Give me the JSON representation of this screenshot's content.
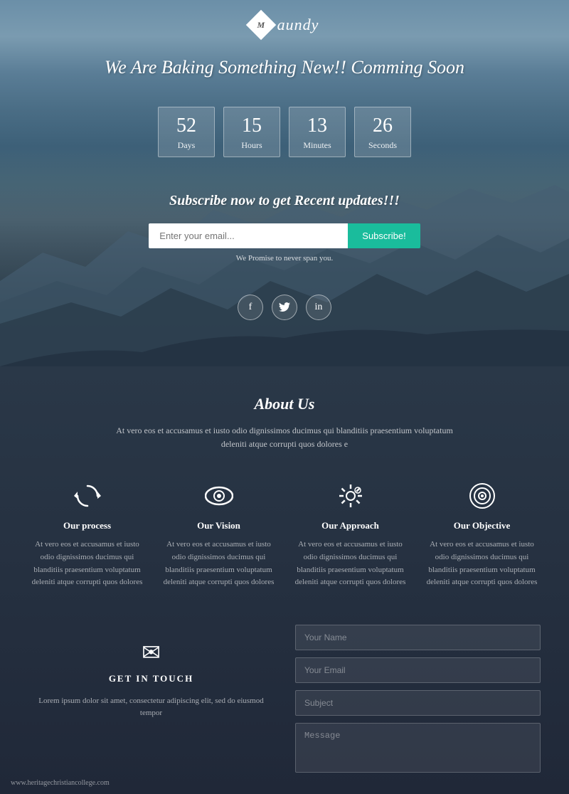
{
  "logo": {
    "diamond_letter": "M",
    "name": "aundy"
  },
  "hero": {
    "headline": "We Are Baking Something New!! Comming Soon",
    "countdown": {
      "days": {
        "value": "52",
        "label": "Days"
      },
      "hours": {
        "value": "15",
        "label": "Hours"
      },
      "minutes": {
        "value": "13",
        "label": "Minutes"
      },
      "seconds": {
        "value": "26",
        "label": "Seconds"
      }
    },
    "subscribe": {
      "title": "Subscribe now to get Recent updates!!!",
      "input_placeholder": "Enter your email...",
      "button_label": "Subscribe!",
      "note": "We Promise to never span you."
    }
  },
  "social": [
    {
      "name": "facebook",
      "symbol": "f"
    },
    {
      "name": "twitter",
      "symbol": "t"
    },
    {
      "name": "linkedin",
      "symbol": "in"
    }
  ],
  "about": {
    "title": "About Us",
    "text": "At vero eos et accusamus et iusto odio dignissimos ducimus qui blanditiis praesentium voluptatum deleniti atque corrupti quos dolores e"
  },
  "features": [
    {
      "title": "Our process",
      "text": "At vero eos et accusamus et iusto odio dignissimos ducimus qui blanditiis praesentium voluptatum deleniti atque corrupti quos dolores"
    },
    {
      "title": "Our Vision",
      "text": "At vero eos et accusamus et iusto odio dignissimos ducimus qui blanditiis praesentium voluptatum deleniti atque corrupti quos dolores"
    },
    {
      "title": "Our Approach",
      "text": "At vero eos et accusamus et iusto odio dignissimos ducimus qui blanditiis praesentium voluptatum deleniti atque corrupti quos dolores"
    },
    {
      "title": "Our Objective",
      "text": "At vero eos et accusamus et iusto odio dignissimos ducimus qui blanditiis praesentium voluptatum deleniti atque corrupti quos dolores"
    }
  ],
  "contact": {
    "icon": "✉",
    "title": "GET IN TOUCH",
    "description": "Lorem ipsum dolor sit amet, consectetur adipiscing elit, sed do eiusmod tempor",
    "form": {
      "name_placeholder": "Your Name",
      "email_placeholder": "Your Email",
      "subject_placeholder": "Subject",
      "message_placeholder": "Message"
    }
  },
  "footer": {
    "watermark": "www.heritagechristiancollege.com"
  },
  "colors": {
    "accent": "#1abc9c",
    "white": "#ffffff",
    "dark_bg": "#253040"
  }
}
